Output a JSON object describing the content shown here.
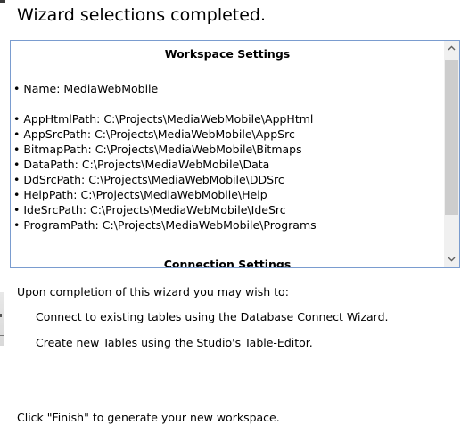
{
  "header": {
    "title": "Wizard selections completed."
  },
  "settings": {
    "workspace_heading": "Workspace Settings",
    "name": "• Name:  MediaWebMobile",
    "paths": [
      "• AppHtmlPath:  C:\\Projects\\MediaWebMobile\\AppHtml",
      "• AppSrcPath:  C:\\Projects\\MediaWebMobile\\AppSrc",
      "• BitmapPath:  C:\\Projects\\MediaWebMobile\\Bitmaps",
      "• DataPath:  C:\\Projects\\MediaWebMobile\\Data",
      "• DdSrcPath:  C:\\Projects\\MediaWebMobile\\DDSrc",
      "• HelpPath:  C:\\Projects\\MediaWebMobile\\Help",
      "• IdeSrcPath:  C:\\Projects\\MediaWebMobile\\IdeSrc",
      "• ProgramPath:  C:\\Projects\\MediaWebMobile\\Programs"
    ],
    "connection_heading": "Connection Settings",
    "scroll_up_icon": "chevron-up-icon",
    "scroll_down_icon": "chevron-down-icon"
  },
  "instructions": {
    "intro": "Upon completion of this wizard you may wish to:",
    "option_1": "Connect to existing tables using the Database Connect Wizard.",
    "option_2": "Create new Tables using the Studio's Table-Editor.",
    "finish": "Click \"Finish\" to generate your new workspace."
  },
  "colors": {
    "box_border": "#7a9ccf",
    "scroll_track": "#f0f0f0",
    "scroll_thumb": "#cdcdcd"
  }
}
